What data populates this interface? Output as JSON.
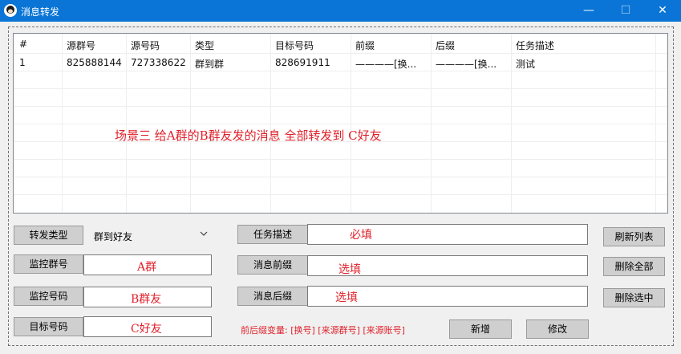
{
  "window": {
    "title": "消息转发",
    "min_label": "—",
    "max_label": "☐",
    "close_label": "✕"
  },
  "table": {
    "columns": [
      "#",
      "源群号",
      "源号码",
      "类型",
      "目标号码",
      "前缀",
      "后缀",
      "任务描述"
    ],
    "rows": [
      [
        "1",
        "825888144",
        "727338622",
        "群到群",
        "828691911",
        "————[换...",
        "————[换...",
        "测试"
      ]
    ]
  },
  "scenario_text": "场景三  给A群的B群友发的消息 全部转发到 C好友",
  "form": {
    "forward_type_label": "转发类型",
    "forward_type_value": "群到好友",
    "monitor_group_label": "监控群号",
    "monitor_group_value": "A群",
    "monitor_number_label": "监控号码",
    "monitor_number_value": "B群友",
    "target_number_label": "目标号码",
    "target_number_value": "C好友",
    "task_desc_label": "任务描述",
    "task_desc_value": "必填",
    "prefix_label": "消息前缀",
    "prefix_value": "选填",
    "suffix_label": "消息后缀",
    "suffix_value": "选填",
    "variables_hint": "前后缀变量: [换号] [来源群号] [来源账号]"
  },
  "buttons": {
    "refresh": "刷新列表",
    "delete_all": "删除全部",
    "delete_selected": "删除选中",
    "add": "新增",
    "edit": "修改"
  }
}
